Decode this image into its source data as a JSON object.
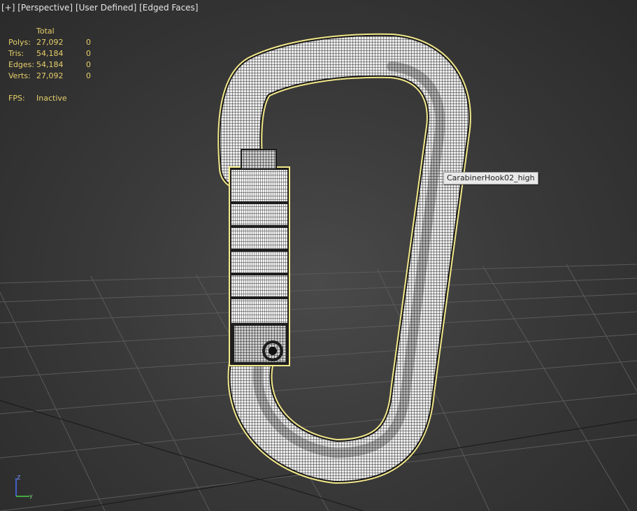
{
  "viewport_menu": {
    "plus": "[+]",
    "view": "[Perspective]",
    "camera": "[User Defined]",
    "shading": "[Edged Faces]"
  },
  "stats": {
    "header": "Total",
    "rows": [
      {
        "label": "Polys:",
        "total": "27,092",
        "selected": "0"
      },
      {
        "label": "Tris:",
        "total": "54,184",
        "selected": "0"
      },
      {
        "label": "Edges:",
        "total": "54,184",
        "selected": "0"
      },
      {
        "label": "Verts:",
        "total": "27,092",
        "selected": "0"
      }
    ],
    "fps_label": "FPS:",
    "fps_value": "Inactive"
  },
  "object_tooltip": "CarabinerHook02_high",
  "gizmo": {
    "z": "Z",
    "y": "y"
  },
  "colors": {
    "stats_text": "#e7cf6a",
    "selection_outline": "#f2e88a",
    "tooltip_bg": "#e9e9e9",
    "grid": "#5a5a5a"
  }
}
